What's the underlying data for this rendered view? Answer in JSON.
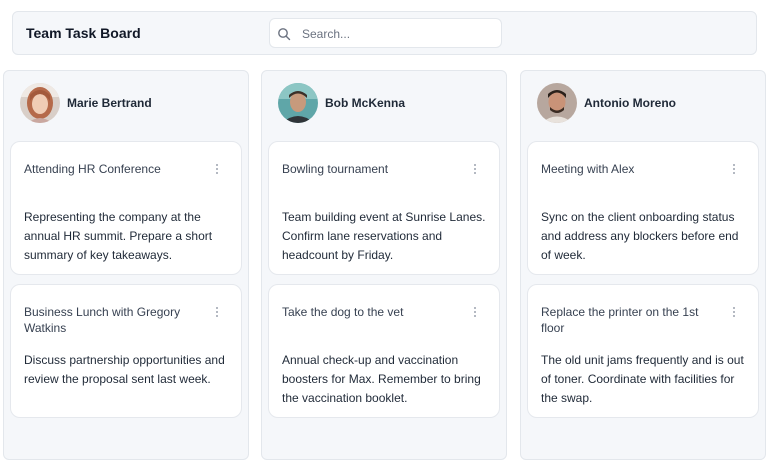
{
  "header": {
    "title": "Team Task Board",
    "search_placeholder": "Search..."
  },
  "columns": [
    {
      "name": "Marie Bertrand",
      "cards": [
        {
          "title": "Attending HR Conference",
          "description": "Representing the company at the annual HR summit. Prepare a short summary of key takeaways."
        },
        {
          "title": "Business Lunch with Gregory Watkins",
          "description": "Discuss partnership opportunities and review the proposal sent last week."
        }
      ]
    },
    {
      "name": "Bob McKenna",
      "cards": [
        {
          "title": "Bowling tournament",
          "description": "Team building event at Sunrise Lanes. Confirm lane reservations and headcount by Friday."
        },
        {
          "title": "Take the dog to the vet",
          "description": "Annual check-up and vaccination boosters for Max. Remember to bring the vaccination booklet."
        }
      ]
    },
    {
      "name": "Antonio Moreno",
      "cards": [
        {
          "title": "Meeting with Alex",
          "description": "Sync on the client onboarding status and address any blockers before end of week."
        },
        {
          "title": "Replace the printer on the 1st floor",
          "description": "The old unit jams frequently and is out of toner. Coordinate with facilities for the swap."
        }
      ]
    }
  ],
  "icons": {
    "search": "search-icon",
    "card_menu": "more-vertical-icon"
  }
}
